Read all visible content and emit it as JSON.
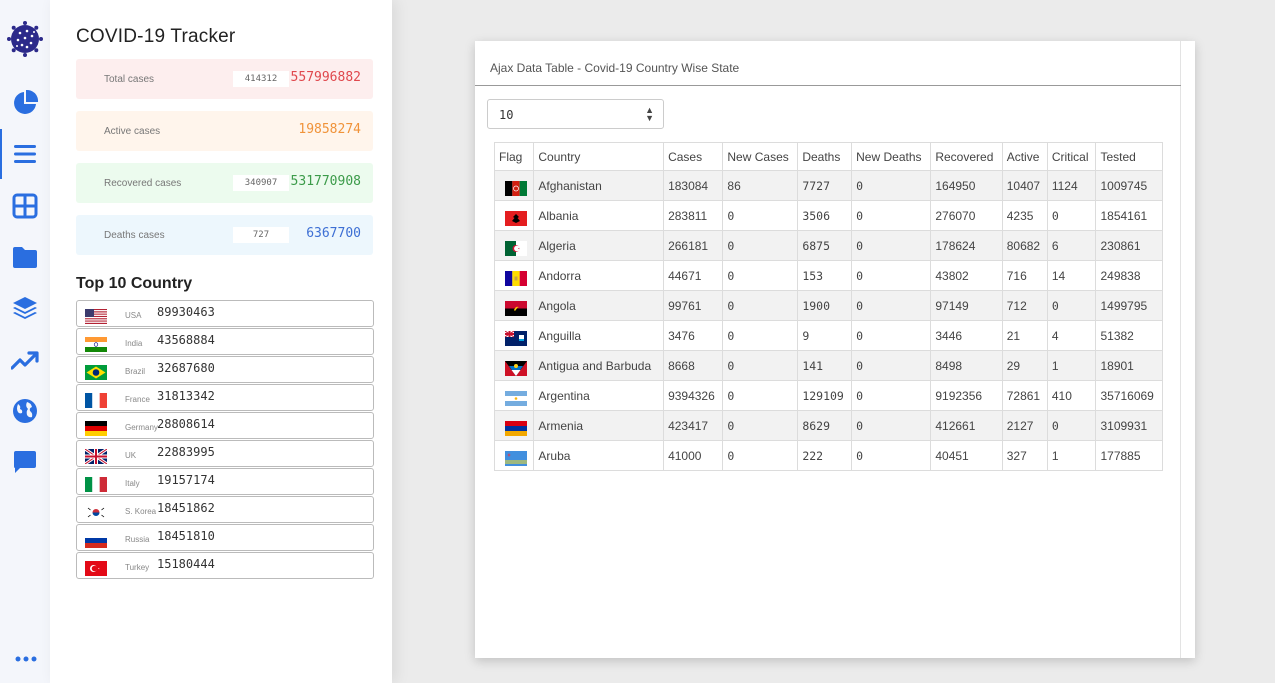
{
  "app": {
    "title": "COVID-19 Tracker"
  },
  "rail": {
    "icons": [
      "virus-logo-icon",
      "pie-chart-icon",
      "list-icon",
      "grid-icon",
      "folder-icon",
      "layers-icon",
      "trend-up-icon",
      "globe-icon",
      "chat-icon",
      "more-icon"
    ],
    "accent": "#2a6ee0"
  },
  "stats": {
    "total": {
      "label": "Total cases",
      "delta": "414312",
      "value": "557996882"
    },
    "active": {
      "label": "Active cases",
      "value": "19858274"
    },
    "recovered": {
      "label": "Recovered cases",
      "delta": "340907",
      "value": "531770908"
    },
    "deaths": {
      "label": "Deaths cases",
      "delta": "727",
      "value": "6367700"
    }
  },
  "top_countries": {
    "title": "Top 10 Country",
    "items": [
      {
        "name": "USA",
        "value": "89930463",
        "flag": "us"
      },
      {
        "name": "India",
        "value": "43568884",
        "flag": "in"
      },
      {
        "name": "Brazil",
        "value": "32687680",
        "flag": "br"
      },
      {
        "name": "France",
        "value": "31813342",
        "flag": "fr"
      },
      {
        "name": "Germany",
        "value": "28808614",
        "flag": "de"
      },
      {
        "name": "UK",
        "value": "22883995",
        "flag": "gb"
      },
      {
        "name": "Italy",
        "value": "19157174",
        "flag": "it"
      },
      {
        "name": "S. Korea",
        "value": "18451862",
        "flag": "kr"
      },
      {
        "name": "Russia",
        "value": "18451810",
        "flag": "ru"
      },
      {
        "name": "Turkey",
        "value": "15180444",
        "flag": "tr"
      }
    ]
  },
  "table_card": {
    "title": "Ajax Data Table - Covid-19 Country Wise State",
    "page_size": "10",
    "columns": [
      "Flag",
      "Country",
      "Cases",
      "New Cases",
      "Deaths",
      "New Deaths",
      "Recovered",
      "Active",
      "Critical",
      "Tested"
    ],
    "rows": [
      {
        "flag": "af",
        "country": "Afghanistan",
        "cases": "183084",
        "new_cases": "86",
        "deaths": "7727",
        "new_deaths": "0",
        "recovered": "164950",
        "active": "10407",
        "critical": "1124",
        "tested": "1009745"
      },
      {
        "flag": "al",
        "country": "Albania",
        "cases": "283811",
        "new_cases": "0",
        "deaths": "3506",
        "new_deaths": "0",
        "recovered": "276070",
        "active": "4235",
        "critical": "0",
        "tested": "1854161"
      },
      {
        "flag": "dz",
        "country": "Algeria",
        "cases": "266181",
        "new_cases": "0",
        "deaths": "6875",
        "new_deaths": "0",
        "recovered": "178624",
        "active": "80682",
        "critical": "6",
        "tested": "230861"
      },
      {
        "flag": "ad",
        "country": "Andorra",
        "cases": "44671",
        "new_cases": "0",
        "deaths": "153",
        "new_deaths": "0",
        "recovered": "43802",
        "active": "716",
        "critical": "14",
        "tested": "249838"
      },
      {
        "flag": "ao",
        "country": "Angola",
        "cases": "99761",
        "new_cases": "0",
        "deaths": "1900",
        "new_deaths": "0",
        "recovered": "97149",
        "active": "712",
        "critical": "0",
        "tested": "1499795"
      },
      {
        "flag": "ai",
        "country": "Anguilla",
        "cases": "3476",
        "new_cases": "0",
        "deaths": "9",
        "new_deaths": "0",
        "recovered": "3446",
        "active": "21",
        "critical": "4",
        "tested": "51382"
      },
      {
        "flag": "ag",
        "country": "Antigua and Barbuda",
        "cases": "8668",
        "new_cases": "0",
        "deaths": "141",
        "new_deaths": "0",
        "recovered": "8498",
        "active": "29",
        "critical": "1",
        "tested": "18901"
      },
      {
        "flag": "ar",
        "country": "Argentina",
        "cases": "9394326",
        "new_cases": "0",
        "deaths": "129109",
        "new_deaths": "0",
        "recovered": "9192356",
        "active": "72861",
        "critical": "410",
        "tested": "35716069"
      },
      {
        "flag": "am",
        "country": "Armenia",
        "cases": "423417",
        "new_cases": "0",
        "deaths": "8629",
        "new_deaths": "0",
        "recovered": "412661",
        "active": "2127",
        "critical": "0",
        "tested": "3109931"
      },
      {
        "flag": "aw",
        "country": "Aruba",
        "cases": "41000",
        "new_cases": "0",
        "deaths": "222",
        "new_deaths": "0",
        "recovered": "40451",
        "active": "327",
        "critical": "1",
        "tested": "177885"
      }
    ]
  }
}
